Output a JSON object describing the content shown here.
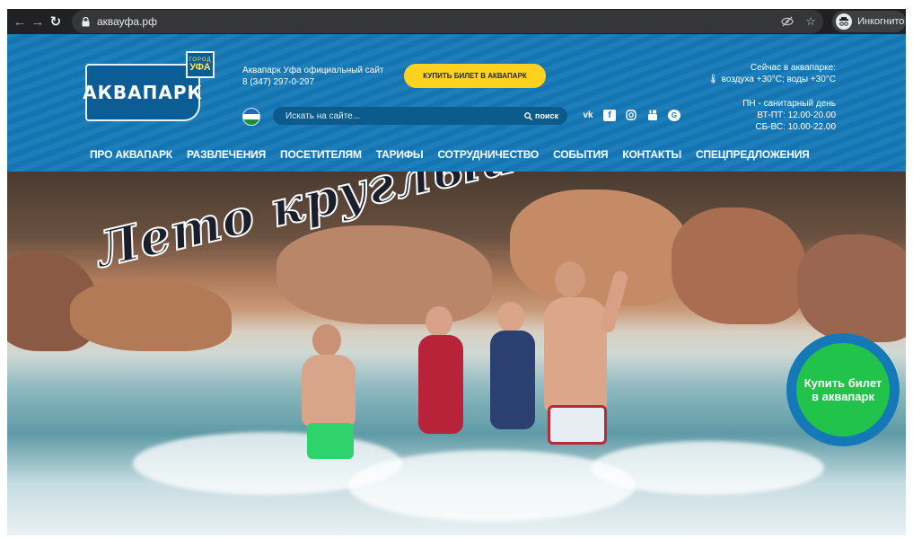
{
  "browser": {
    "url": "аквауфа.рф",
    "profile_label": "Инкогнито",
    "icons": [
      "back-arrow-icon",
      "forward-arrow-icon",
      "reload-icon",
      "lock-icon",
      "eye-off-icon",
      "star-icon",
      "incognito-icon"
    ]
  },
  "header": {
    "logo": {
      "word": "АКВАПАРК",
      "badge_small": "ГОРОД",
      "badge_big": "УФА"
    },
    "site_title": "Аквапарк Уфа официальный сайт",
    "phone": "8 (347) 297-0-297",
    "buy_button": "КУПИТЬ БИЛЕТ В АКВАПАРК",
    "weather_title": "Сейчас в аквапарке:",
    "weather_values": "воздуха +30°C; воды +30°C",
    "hours": [
      "ПН - санитарный день",
      "ВТ-ПТ: 12.00-20.00",
      "СБ-ВС: 10.00-22.00"
    ],
    "search": {
      "placeholder": "Искать на сайте...",
      "button": "поиск"
    },
    "social": [
      "vk-icon",
      "facebook-icon",
      "instagram-icon",
      "youtube-icon",
      "google-plus-icon"
    ]
  },
  "menu": [
    "ПРО АКВАПАРК",
    "РАЗВЛЕЧЕНИЯ",
    "ПОСЕТИТЕЛЯМ",
    "ТАРИФЫ",
    "СОТРУДНИЧЕСТВО",
    "СОБЫТИЯ",
    "КОНТАКТЫ",
    "СПЕЦПРЕДЛОЖЕНИЯ"
  ],
  "hero": {
    "slogan": "Лето круглый год!",
    "buy_circle": "Купить билет в аквапарк"
  },
  "colors": {
    "header_blue": "#1579b8",
    "button_yellow": "#ffd21f",
    "cta_green": "#21c34a"
  }
}
